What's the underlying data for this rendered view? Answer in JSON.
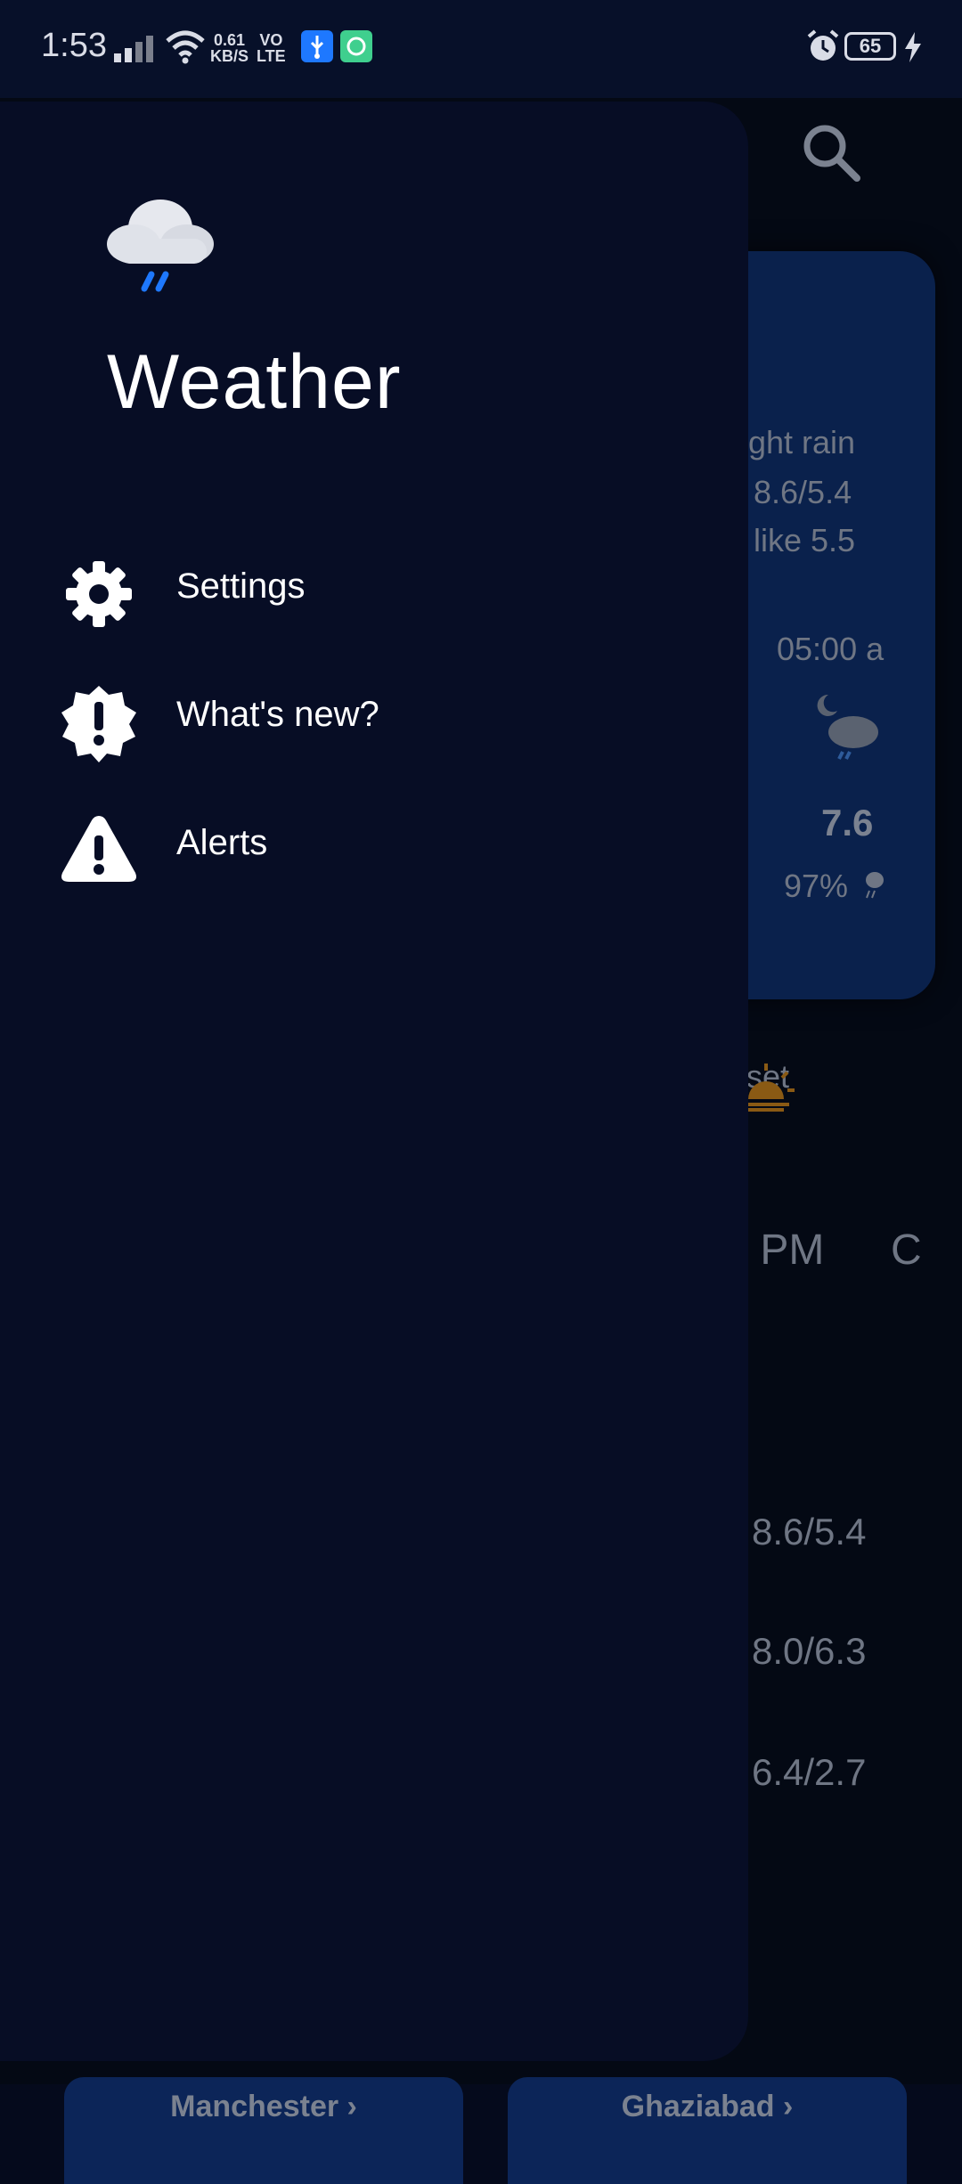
{
  "status_bar": {
    "time": "1:53",
    "net_speed_top": "0.61",
    "net_speed_bottom": "KB/S",
    "volte_top": "VO",
    "volte_bottom": "LTE",
    "battery": "65"
  },
  "drawer": {
    "title": "Weather",
    "logo_icon": "rain-cloud-icon",
    "items": [
      {
        "label": "Settings",
        "icon": "gear-icon"
      },
      {
        "label": "What's new?",
        "icon": "alert-badge-icon"
      },
      {
        "label": "Alerts",
        "icon": "warning-triangle-icon"
      }
    ]
  },
  "background": {
    "condition": "ght rain",
    "hi_lo": "8.6/5.4",
    "feels_like": "like 5.5",
    "hour_time": "05:00 a",
    "hour_temp": "7.6",
    "hour_humidity": "97%",
    "sunset_label": "set",
    "sunset_time": ") PM",
    "sunset_time_next": "C",
    "day1": "8.6/5.4",
    "day2": "8.0/6.3",
    "day3": "6.4/2.7",
    "city1": "Manchester",
    "city2": "Ghaziabad"
  },
  "colors": {
    "drawer_bg": "#070d25",
    "card_bg": "#0a214c",
    "accent": "#1e78ff"
  }
}
